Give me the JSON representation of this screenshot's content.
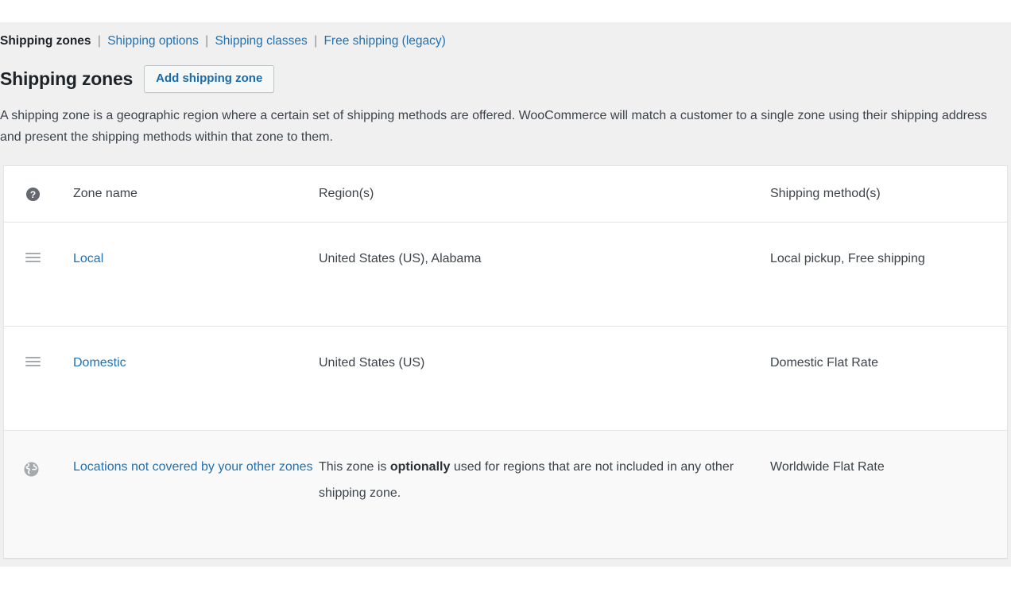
{
  "nav": {
    "separator": "|",
    "items": [
      {
        "label": "Shipping zones",
        "current": true
      },
      {
        "label": "Shipping options",
        "current": false
      },
      {
        "label": "Shipping classes",
        "current": false
      },
      {
        "label": "Free shipping (legacy)",
        "current": false
      }
    ]
  },
  "header": {
    "title": "Shipping zones",
    "add_button_label": "Add shipping zone"
  },
  "intro": "A shipping zone is a geographic region where a certain set of shipping methods are offered. WooCommerce will match a customer to a single zone using their shipping address and present the shipping methods within that zone to them.",
  "table": {
    "columns": {
      "handle": "",
      "zone_name": "Zone name",
      "regions": "Region(s)",
      "methods": "Shipping method(s)"
    },
    "header_icon": "help-icon",
    "rows": [
      {
        "icon": "drag-handle-icon",
        "zone_name": "Local",
        "regions": "United States (US), Alabama",
        "regions_emphasis": "",
        "methods": "Local pickup, Free shipping",
        "is_rest_of_world": false
      },
      {
        "icon": "drag-handle-icon",
        "zone_name": "Domestic",
        "regions": "United States (US)",
        "regions_emphasis": "",
        "methods": "Domestic Flat Rate",
        "is_rest_of_world": false
      },
      {
        "icon": "globe-icon",
        "zone_name": "Locations not covered by your other zones",
        "regions_prefix": "This zone is ",
        "regions_emphasis": "optionally",
        "regions_suffix": " used for regions that are not included in any other shipping zone.",
        "methods": "Worldwide Flat Rate",
        "is_rest_of_world": true
      }
    ]
  },
  "colors": {
    "link": "#2271b1",
    "page_background": "#f0f0f1",
    "table_background": "#ffffff",
    "rest_of_world_background": "#f9f9f9",
    "text": "#3c434a",
    "heading": "#1d2327",
    "border": "#e4e4e5",
    "icon_gray": "#a7aaad",
    "help_icon_dark": "#646970"
  }
}
